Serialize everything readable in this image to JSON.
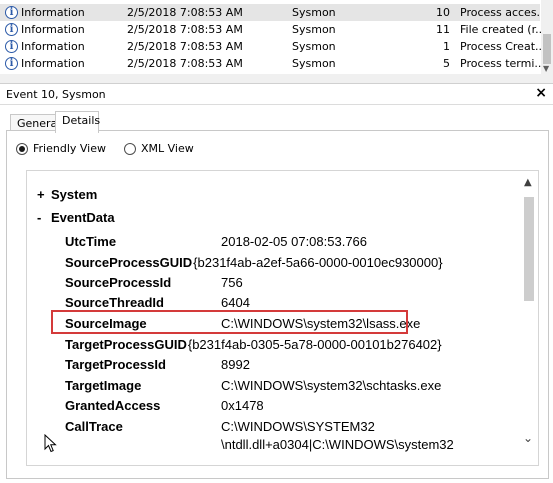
{
  "events": [
    {
      "level": "Information",
      "date": "2/5/2018 7:08:53 AM",
      "source": "Sysmon",
      "event_id": "10",
      "task": "Process acces...",
      "selected": true
    },
    {
      "level": "Information",
      "date": "2/5/2018 7:08:53 AM",
      "source": "Sysmon",
      "event_id": "11",
      "task": "File created (r...",
      "selected": false
    },
    {
      "level": "Information",
      "date": "2/5/2018 7:08:53 AM",
      "source": "Sysmon",
      "event_id": "1",
      "task": "Process Creat...",
      "selected": false
    },
    {
      "level": "Information",
      "date": "2/5/2018 7:08:53 AM",
      "source": "Sysmon",
      "event_id": "5",
      "task": "Process termi...",
      "selected": false
    }
  ],
  "event_icon_glyph": "i",
  "details_pane": {
    "title": "Event 10, Sysmon",
    "close_glyph": "×",
    "tabs": [
      "General",
      "Details"
    ],
    "active_tab": "Details",
    "view_options": {
      "friendly": "Friendly View",
      "xml": "XML View",
      "selected": "Friendly View"
    }
  },
  "event_details": {
    "system": {
      "toggle": "+",
      "label": "System"
    },
    "event_data": {
      "toggle": "-",
      "label": "EventData"
    },
    "fields": [
      {
        "name": "UtcTime",
        "value": "2018-02-05 07:08:53.766"
      },
      {
        "name": "SourceProcessGUID",
        "value": "{b231f4ab-a2ef-5a66-0000-0010ec930000}"
      },
      {
        "name": "SourceProcessId",
        "value": "756"
      },
      {
        "name": "SourceThreadId",
        "value": "6404"
      },
      {
        "name": "SourceImage",
        "value": "C:\\WINDOWS\\system32\\lsass.exe",
        "highlighted": true
      },
      {
        "name": "TargetProcessGUID",
        "value": "{b231f4ab-0305-5a78-0000-00101b276402}"
      },
      {
        "name": "TargetProcessId",
        "value": "8992"
      },
      {
        "name": "TargetImage",
        "value": "C:\\WINDOWS\\system32\\schtasks.exe"
      },
      {
        "name": "GrantedAccess",
        "value": "0x1478"
      },
      {
        "name": "CallTrace",
        "value": "C:\\WINDOWS\\SYSTEM32",
        "continuation": "\\ntdll.dll+a0304|C:\\WINDOWS\\system32"
      }
    ]
  },
  "colors": {
    "highlight_border": "#d43a3a",
    "info_icon": "#2c5aa8",
    "selected_row": "#e5e5e5"
  }
}
